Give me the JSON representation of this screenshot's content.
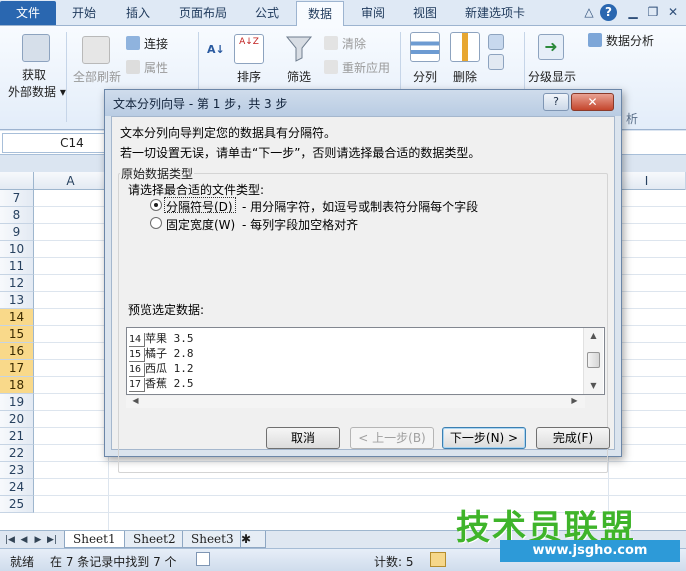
{
  "ribbon_tabs": [
    "文件",
    "开始",
    "插入",
    "页面布局",
    "公式",
    "数据",
    "审阅",
    "视图",
    "新建选项卡"
  ],
  "window_controls": {
    "minimize": "△",
    "help": "?",
    "restore": "❐",
    "close": "✕"
  },
  "ribbon": {
    "get_external": [
      "获取",
      "外部数据 ▾"
    ],
    "refresh_all": "全部刷新",
    "connections": "连接",
    "properties": "属性",
    "sort_az": "A↓Z",
    "sort": "排序",
    "filter": "筛选",
    "clear": "清除",
    "reapply": "重新应用",
    "split_column": "分列",
    "remove_dup": "删除",
    "outline": "分级显示",
    "data_analysis": "数据分析",
    "analysis_group": "析"
  },
  "formula_bar": {
    "name_box": "C14"
  },
  "columns": [
    "A",
    "I"
  ],
  "rows": [
    "7",
    "8",
    "9",
    "10",
    "11",
    "12",
    "13",
    "14",
    "15",
    "16",
    "17",
    "18",
    "19",
    "20",
    "21",
    "22",
    "23",
    "24",
    "25"
  ],
  "sheet_tabs": [
    "Sheet1",
    "Sheet2",
    "Sheet3"
  ],
  "status": {
    "ready": "就绪",
    "find_result": "在 7 条记录中找到 7 个",
    "count": "计数: 5"
  },
  "dialog": {
    "title": "文本分列向导 - 第 1 步，共 3 步",
    "line1": "文本分列向导判定您的数据具有分隔符。",
    "line2": "若一切设置无误，请单击“下一步”，否则请选择最合适的数据类型。",
    "group_title": "原始数据类型",
    "choose_label": "请选择最合适的文件类型:",
    "option_delimited": "分隔符号(D)",
    "option_delimited_desc": "- 用分隔字符，如逗号或制表符分隔每个字段",
    "option_fixed": "固定宽度(W)",
    "option_fixed_desc": "- 每列字段加空格对齐",
    "preview_label": "预览选定数据:",
    "preview_rows": [
      {
        "num": "14",
        "text": "苹果 3.5"
      },
      {
        "num": "15",
        "text": "橘子 2.8"
      },
      {
        "num": "16",
        "text": "西瓜 1.2"
      },
      {
        "num": "17",
        "text": "香蕉 2.5"
      }
    ],
    "buttons": {
      "cancel": "取消",
      "prev": "< 上一步(B)",
      "next": "下一步(N) >",
      "finish": "完成(F)"
    }
  },
  "watermark": {
    "brand": "技术员联盟",
    "url": "www.jsgho.com"
  }
}
